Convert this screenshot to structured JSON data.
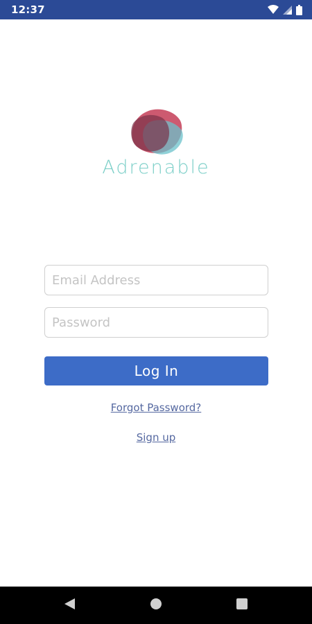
{
  "status_bar": {
    "time": "12:37",
    "icons": [
      "wifi-icon",
      "signal-icon",
      "battery-icon"
    ],
    "color": "#2b4a96"
  },
  "brand": {
    "name": "Adrenable",
    "text_color": "#7ccfc8",
    "logo_colors": [
      "#c43d57",
      "#6bc2cb",
      "#8a3a52"
    ]
  },
  "login_form": {
    "email_placeholder": "Email Address",
    "email_value": "",
    "password_placeholder": "Password",
    "password_value": "",
    "login_label": "Log In",
    "button_color": "#3d6cc7"
  },
  "links": {
    "forgot_password": "Forgot Password?",
    "sign_up": "Sign up"
  },
  "nav_bar": {
    "buttons": [
      "back-icon",
      "home-icon",
      "recents-icon"
    ]
  }
}
